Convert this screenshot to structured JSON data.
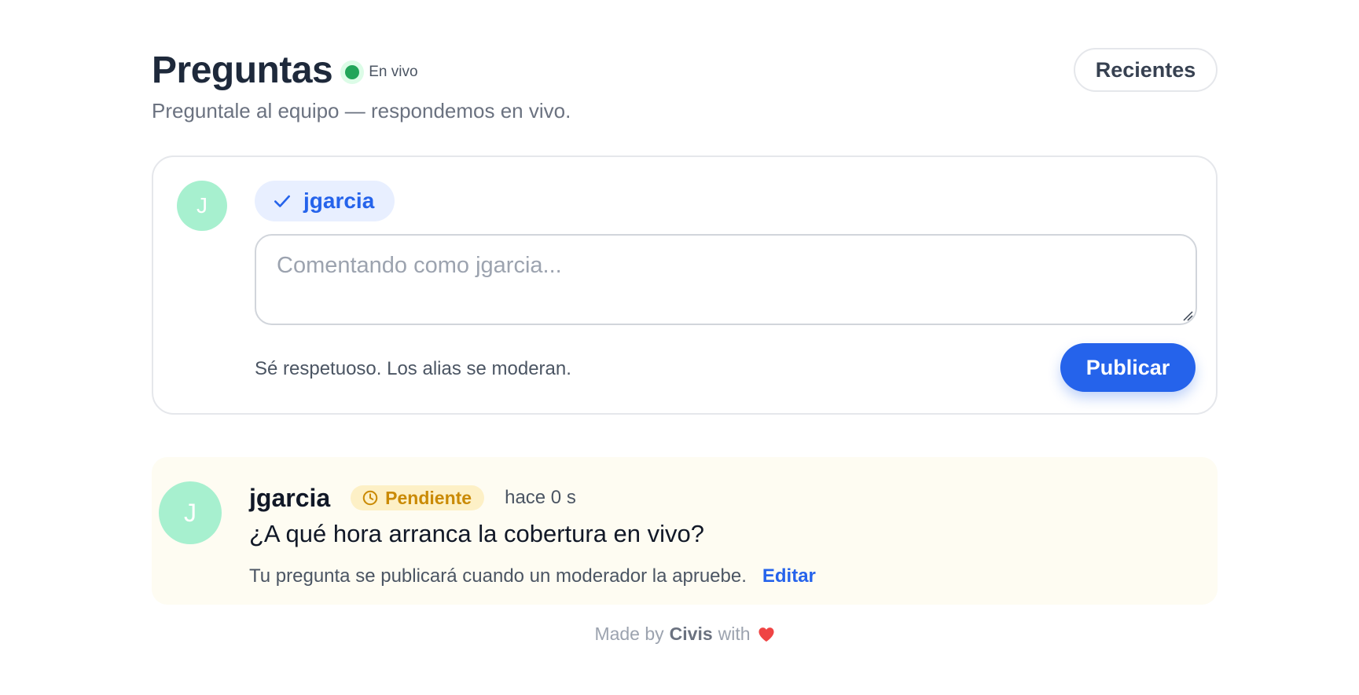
{
  "header": {
    "title": "Preguntas",
    "live_label": "En vivo",
    "subtitle": "Preguntale al equipo — respondemos en vivo.",
    "sort_label": "Recientes"
  },
  "composer": {
    "avatar_initial": "J",
    "username": "jgarcia",
    "placeholder": "Comentando como jgarcia...",
    "hint": "Sé respetuoso. Los alias se moderan.",
    "publish_label": "Publicar"
  },
  "question": {
    "avatar_initial": "J",
    "author": "jgarcia",
    "status": "Pendiente",
    "time": "hace 0 s",
    "text": "¿A qué hora arranca la cobertura en vivo?",
    "note": "Tu pregunta se publicará cuando un moderador la apruebe.",
    "edit_label": "Editar"
  },
  "footer": {
    "prefix": "Made by",
    "brand": "Civis",
    "suffix": "with"
  },
  "icons": {
    "live": "live-dot-icon",
    "check": "check-icon",
    "clock": "clock-icon",
    "heart": "heart-icon"
  },
  "colors": {
    "accent": "#2563eb",
    "live": "#22a559",
    "avatar": "#a7f0cf",
    "pending": "#ca8a04",
    "pending_bg": "#fdf0c6",
    "card_bg": "#fefcf2",
    "heart": "#ef4444"
  }
}
